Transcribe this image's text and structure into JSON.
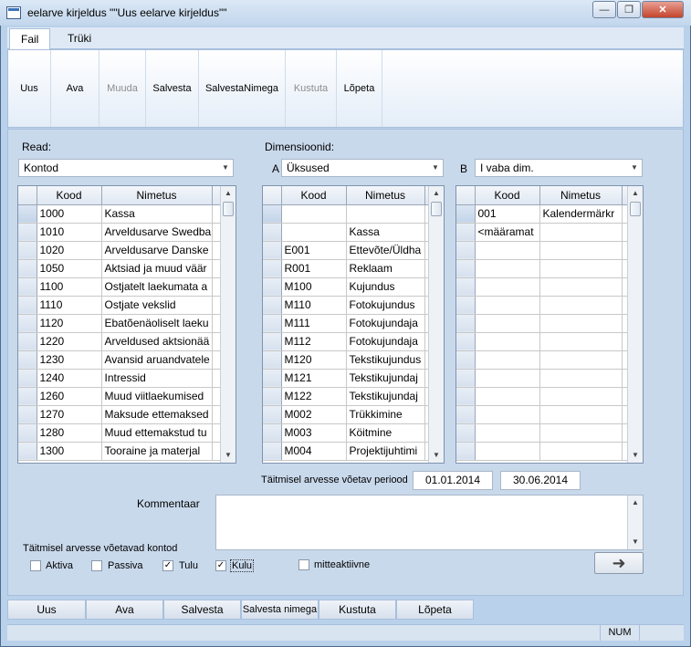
{
  "window": {
    "title": "eelarve kirjeldus \"\"Uus eelarve kirjeldus\"\"",
    "minimize": "—",
    "restore": "❐",
    "close": "✕"
  },
  "ribbon": {
    "tabs": [
      "Fail",
      "Trüki"
    ],
    "buttons": [
      {
        "label": "Uus",
        "enabled": true
      },
      {
        "label": "Ava",
        "enabled": true
      },
      {
        "label": "Muuda",
        "enabled": false
      },
      {
        "label": "Salvesta",
        "enabled": true
      },
      {
        "label": "SalvestaNimega",
        "enabled": true
      },
      {
        "label": "Kustuta",
        "enabled": false
      },
      {
        "label": "Lõpeta",
        "enabled": true
      }
    ]
  },
  "form": {
    "read_label": "Read:",
    "read_value": "Kontod",
    "dim_label": "Dimensioonid:",
    "dim_a_letter": "A",
    "dim_a_value": "Üksused",
    "dim_b_letter": "B",
    "dim_b_value": "I vaba dim.",
    "period_label": "Täitmisel arvesse võetav periood",
    "period_from": "01.01.2014",
    "period_to": "30.06.2014",
    "comment_label": "Kommentaar",
    "accounts_label": "Täitmisel arvesse võetavad kontod",
    "checkboxes": [
      {
        "label": "Aktiva",
        "checked": false
      },
      {
        "label": "Passiva",
        "checked": false
      },
      {
        "label": "Tulu",
        "checked": true
      },
      {
        "label": "Kulu",
        "checked": true
      },
      {
        "label": "mitteaktiivne",
        "checked": false
      }
    ],
    "arrow": "➜"
  },
  "grid_read": {
    "headers": [
      "Kood",
      "Nimetus"
    ],
    "rows": [
      [
        "1000",
        "Kassa"
      ],
      [
        "1010",
        "Arveldusarve Swedba"
      ],
      [
        "1020",
        "Arveldusarve Danske"
      ],
      [
        "1050",
        "Aktsiad ja muud väär"
      ],
      [
        "1100",
        "Ostjatelt laekumata a"
      ],
      [
        "1110",
        "Ostjate vekslid"
      ],
      [
        "1120",
        "Ebatõenäoliselt laeku"
      ],
      [
        "1220",
        "Arveldused aktsionää"
      ],
      [
        "1230",
        "Avansid aruandvatele"
      ],
      [
        "1240",
        "Intressid"
      ],
      [
        "1260",
        "Muud viitlaekumised"
      ],
      [
        "1270",
        "Maksude ettemaksed"
      ],
      [
        "1280",
        "Muud ettemakstud tu"
      ],
      [
        "1300",
        "Tooraine ja materjal"
      ]
    ]
  },
  "grid_a": {
    "headers": [
      "Kood",
      "Nimetus"
    ],
    "rows": [
      [
        "",
        ""
      ],
      [
        "",
        "Kassa"
      ],
      [
        "E001",
        "Ettevõte/Üldha"
      ],
      [
        "R001",
        "Reklaam"
      ],
      [
        "M100",
        "Kujundus"
      ],
      [
        "M110",
        "Fotokujundus"
      ],
      [
        "M111",
        "Fotokujundaja"
      ],
      [
        "M112",
        "Fotokujundaja"
      ],
      [
        "M120",
        "Tekstikujundus"
      ],
      [
        "M121",
        "Tekstikujundaj"
      ],
      [
        "M122",
        "Tekstikujundaj"
      ],
      [
        "M002",
        "Trükkimine"
      ],
      [
        "M003",
        "Köitmine"
      ],
      [
        "M004",
        "Projektijuhtimi"
      ]
    ]
  },
  "grid_b": {
    "headers": [
      "Kood",
      "Nimetus"
    ],
    "rows": [
      [
        "001",
        "Kalendermärkr"
      ],
      [
        "<määramat",
        ""
      ],
      [
        "",
        ""
      ],
      [
        "",
        ""
      ],
      [
        "",
        ""
      ],
      [
        "",
        ""
      ],
      [
        "",
        ""
      ],
      [
        "",
        ""
      ],
      [
        "",
        ""
      ],
      [
        "",
        ""
      ],
      [
        "",
        ""
      ],
      [
        "",
        ""
      ],
      [
        "",
        ""
      ],
      [
        "",
        ""
      ]
    ]
  },
  "bottom_buttons": [
    "Uus",
    "Ava",
    "Salvesta",
    "Salvesta nimega",
    "Kustuta",
    "Lõpeta"
  ],
  "status": {
    "num": "NUM"
  }
}
